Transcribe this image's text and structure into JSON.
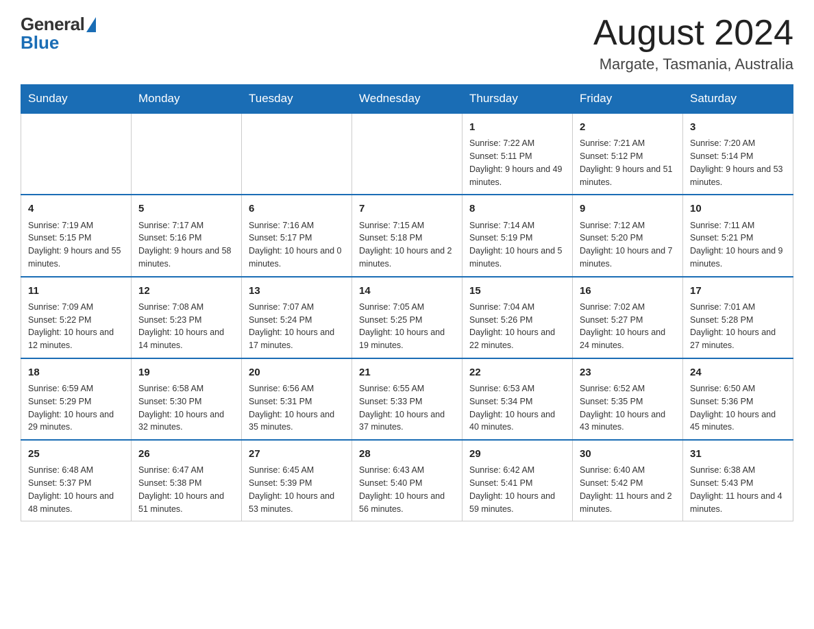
{
  "header": {
    "logo_general": "General",
    "logo_blue": "Blue",
    "month_title": "August 2024",
    "location": "Margate, Tasmania, Australia"
  },
  "days_of_week": [
    "Sunday",
    "Monday",
    "Tuesday",
    "Wednesday",
    "Thursday",
    "Friday",
    "Saturday"
  ],
  "weeks": [
    [
      {
        "day": "",
        "info": ""
      },
      {
        "day": "",
        "info": ""
      },
      {
        "day": "",
        "info": ""
      },
      {
        "day": "",
        "info": ""
      },
      {
        "day": "1",
        "info": "Sunrise: 7:22 AM\nSunset: 5:11 PM\nDaylight: 9 hours\nand 49 minutes."
      },
      {
        "day": "2",
        "info": "Sunrise: 7:21 AM\nSunset: 5:12 PM\nDaylight: 9 hours\nand 51 minutes."
      },
      {
        "day": "3",
        "info": "Sunrise: 7:20 AM\nSunset: 5:14 PM\nDaylight: 9 hours\nand 53 minutes."
      }
    ],
    [
      {
        "day": "4",
        "info": "Sunrise: 7:19 AM\nSunset: 5:15 PM\nDaylight: 9 hours\nand 55 minutes."
      },
      {
        "day": "5",
        "info": "Sunrise: 7:17 AM\nSunset: 5:16 PM\nDaylight: 9 hours\nand 58 minutes."
      },
      {
        "day": "6",
        "info": "Sunrise: 7:16 AM\nSunset: 5:17 PM\nDaylight: 10 hours\nand 0 minutes."
      },
      {
        "day": "7",
        "info": "Sunrise: 7:15 AM\nSunset: 5:18 PM\nDaylight: 10 hours\nand 2 minutes."
      },
      {
        "day": "8",
        "info": "Sunrise: 7:14 AM\nSunset: 5:19 PM\nDaylight: 10 hours\nand 5 minutes."
      },
      {
        "day": "9",
        "info": "Sunrise: 7:12 AM\nSunset: 5:20 PM\nDaylight: 10 hours\nand 7 minutes."
      },
      {
        "day": "10",
        "info": "Sunrise: 7:11 AM\nSunset: 5:21 PM\nDaylight: 10 hours\nand 9 minutes."
      }
    ],
    [
      {
        "day": "11",
        "info": "Sunrise: 7:09 AM\nSunset: 5:22 PM\nDaylight: 10 hours\nand 12 minutes."
      },
      {
        "day": "12",
        "info": "Sunrise: 7:08 AM\nSunset: 5:23 PM\nDaylight: 10 hours\nand 14 minutes."
      },
      {
        "day": "13",
        "info": "Sunrise: 7:07 AM\nSunset: 5:24 PM\nDaylight: 10 hours\nand 17 minutes."
      },
      {
        "day": "14",
        "info": "Sunrise: 7:05 AM\nSunset: 5:25 PM\nDaylight: 10 hours\nand 19 minutes."
      },
      {
        "day": "15",
        "info": "Sunrise: 7:04 AM\nSunset: 5:26 PM\nDaylight: 10 hours\nand 22 minutes."
      },
      {
        "day": "16",
        "info": "Sunrise: 7:02 AM\nSunset: 5:27 PM\nDaylight: 10 hours\nand 24 minutes."
      },
      {
        "day": "17",
        "info": "Sunrise: 7:01 AM\nSunset: 5:28 PM\nDaylight: 10 hours\nand 27 minutes."
      }
    ],
    [
      {
        "day": "18",
        "info": "Sunrise: 6:59 AM\nSunset: 5:29 PM\nDaylight: 10 hours\nand 29 minutes."
      },
      {
        "day": "19",
        "info": "Sunrise: 6:58 AM\nSunset: 5:30 PM\nDaylight: 10 hours\nand 32 minutes."
      },
      {
        "day": "20",
        "info": "Sunrise: 6:56 AM\nSunset: 5:31 PM\nDaylight: 10 hours\nand 35 minutes."
      },
      {
        "day": "21",
        "info": "Sunrise: 6:55 AM\nSunset: 5:33 PM\nDaylight: 10 hours\nand 37 minutes."
      },
      {
        "day": "22",
        "info": "Sunrise: 6:53 AM\nSunset: 5:34 PM\nDaylight: 10 hours\nand 40 minutes."
      },
      {
        "day": "23",
        "info": "Sunrise: 6:52 AM\nSunset: 5:35 PM\nDaylight: 10 hours\nand 43 minutes."
      },
      {
        "day": "24",
        "info": "Sunrise: 6:50 AM\nSunset: 5:36 PM\nDaylight: 10 hours\nand 45 minutes."
      }
    ],
    [
      {
        "day": "25",
        "info": "Sunrise: 6:48 AM\nSunset: 5:37 PM\nDaylight: 10 hours\nand 48 minutes."
      },
      {
        "day": "26",
        "info": "Sunrise: 6:47 AM\nSunset: 5:38 PM\nDaylight: 10 hours\nand 51 minutes."
      },
      {
        "day": "27",
        "info": "Sunrise: 6:45 AM\nSunset: 5:39 PM\nDaylight: 10 hours\nand 53 minutes."
      },
      {
        "day": "28",
        "info": "Sunrise: 6:43 AM\nSunset: 5:40 PM\nDaylight: 10 hours\nand 56 minutes."
      },
      {
        "day": "29",
        "info": "Sunrise: 6:42 AM\nSunset: 5:41 PM\nDaylight: 10 hours\nand 59 minutes."
      },
      {
        "day": "30",
        "info": "Sunrise: 6:40 AM\nSunset: 5:42 PM\nDaylight: 11 hours\nand 2 minutes."
      },
      {
        "day": "31",
        "info": "Sunrise: 6:38 AM\nSunset: 5:43 PM\nDaylight: 11 hours\nand 4 minutes."
      }
    ]
  ]
}
